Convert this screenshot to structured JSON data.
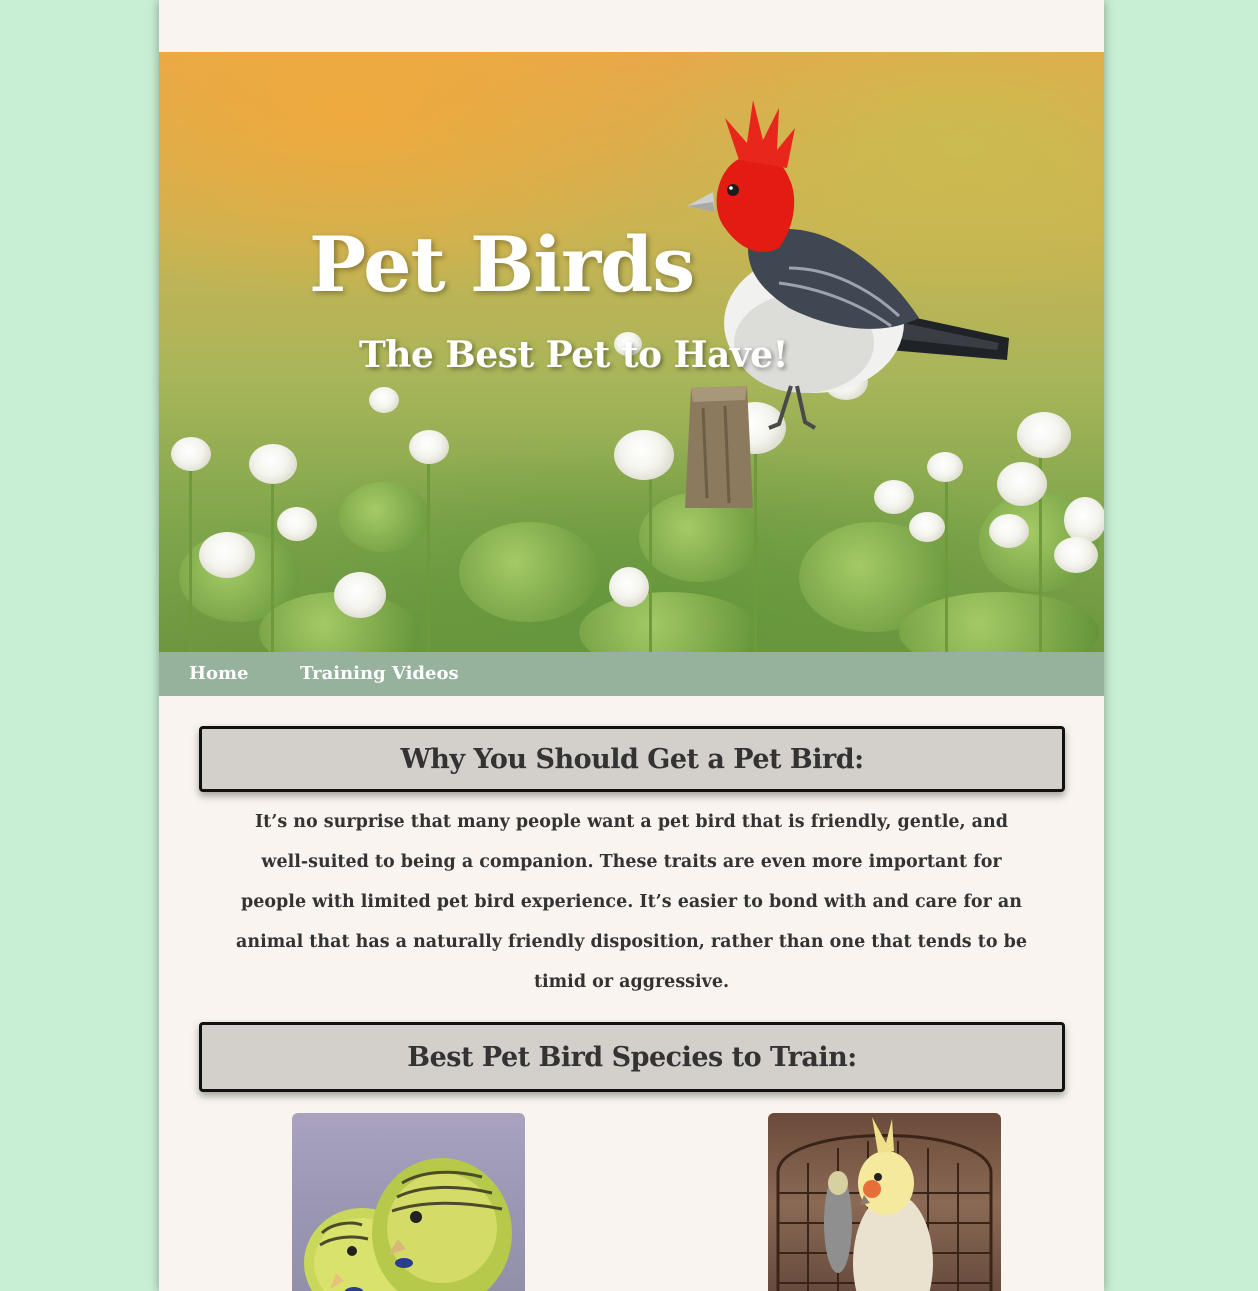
{
  "hero": {
    "title": "Pet Birds",
    "subtitle": "The Best Pet to Have!"
  },
  "nav": {
    "items": [
      {
        "label": "Home"
      },
      {
        "label": "Training Videos"
      }
    ]
  },
  "sections": [
    {
      "heading": "Why You Should Get a Pet Bird:",
      "body": "It’s no surprise that many people want a pet bird that is friendly, gentle, and well-suited to being a companion. These traits are even more important for people with limited pet bird experience. It’s easier to bond with and care for an animal that has a naturally friendly disposition, rather than one that tends to be timid or aggressive."
    },
    {
      "heading": "Best Pet Bird Species to Train:"
    }
  ],
  "images": {
    "hero": "red-crested-cardinal-on-post-in-clover-field",
    "species": [
      "budgerigar-pair-photo",
      "cockatiel-in-cage-photo"
    ]
  },
  "colors": {
    "page_bg": "#c8efd4",
    "content_bg": "#f9f4ef",
    "nav_bg": "#96b19c",
    "heading_box_bg": "#d3cfcb",
    "text": "#333333"
  }
}
